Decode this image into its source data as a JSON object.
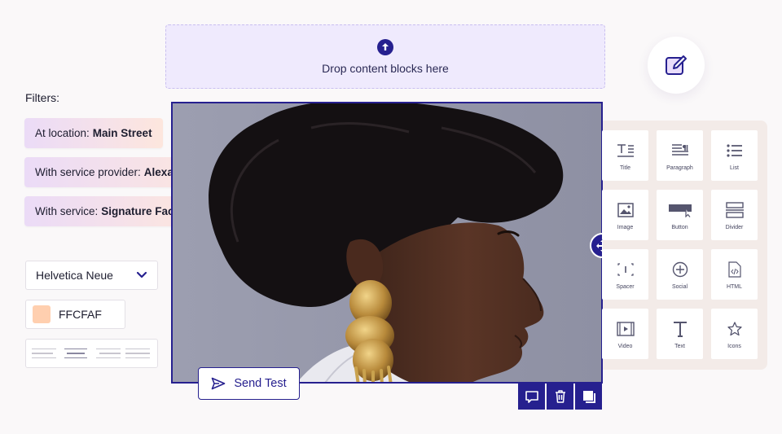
{
  "dropzone": {
    "label": "Drop content blocks here"
  },
  "filters": {
    "title": "Filters:",
    "chips": [
      {
        "prefix": "At location:",
        "value": "Main Street"
      },
      {
        "prefix": "With service provider:",
        "value": "Alexandra"
      },
      {
        "prefix": "With service:",
        "value": "Signature Facial"
      }
    ]
  },
  "typography": {
    "font_value": "Helvetica Neue",
    "color_value": "FFCFAF"
  },
  "send_test": {
    "label": "Send Test"
  },
  "blocks": [
    {
      "label": "Title",
      "icon": "title-icon"
    },
    {
      "label": "Paragraph",
      "icon": "paragraph-icon"
    },
    {
      "label": "List",
      "icon": "list-icon"
    },
    {
      "label": "Image",
      "icon": "image-icon"
    },
    {
      "label": "Button",
      "icon": "button-icon"
    },
    {
      "label": "Divider",
      "icon": "divider-icon"
    },
    {
      "label": "Spacer",
      "icon": "spacer-icon"
    },
    {
      "label": "Social",
      "icon": "social-icon"
    },
    {
      "label": "HTML",
      "icon": "html-icon"
    },
    {
      "label": "Video",
      "icon": "video-icon"
    },
    {
      "label": "Text",
      "icon": "text-icon"
    },
    {
      "label": "Icons",
      "icon": "icons-icon"
    }
  ],
  "colors": {
    "accent": "#26208f",
    "swatch": "#FFCFAF",
    "dropzone_bg": "#efeafd"
  }
}
